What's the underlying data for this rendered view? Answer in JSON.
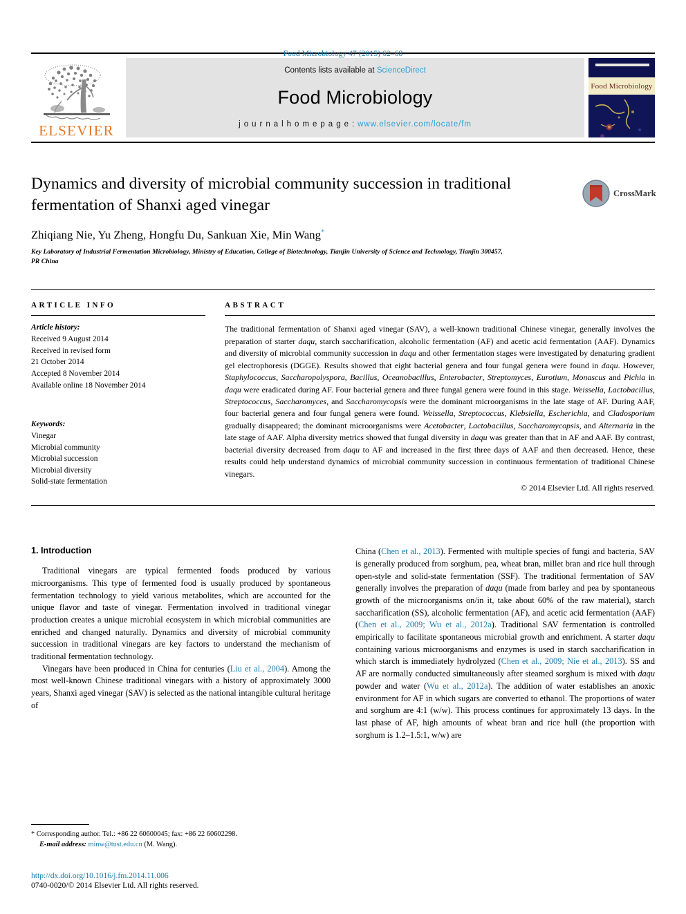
{
  "running_head": "Food Microbiology 47 (2015) 62–68",
  "masthead": {
    "publisher": "ELSEVIER",
    "contents_prefix": "Contents lists available at ",
    "contents_link": "ScienceDirect",
    "journal_name": "Food Microbiology",
    "homepage_prefix": "j o u r n a l   h o m e p a g e :  ",
    "homepage_link": "www.elsevier.com/locate/fm",
    "cover_title": "Food Microbiology"
  },
  "article": {
    "title": "Dynamics and diversity of microbial community succession in traditional fermentation of Shanxi aged vinegar",
    "authors": "Zhiqiang Nie, Yu Zheng, Hongfu Du, Sankuan Xie, Min Wang",
    "corresponding_marker": "*",
    "affiliation": "Key Laboratory of Industrial Fermentation Microbiology, Ministry of Education, College of Biotechnology, Tianjin University of Science and Technology, Tianjin 300457, PR China",
    "crossmark_label": "CrossMark"
  },
  "article_info": {
    "heading": "ARTICLE INFO",
    "history_label": "Article history:",
    "history": [
      "Received 9 August 2014",
      "Received in revised form",
      "21 October 2014",
      "Accepted 8 November 2014",
      "Available online 18 November 2014"
    ],
    "keywords_label": "Keywords:",
    "keywords": [
      "Vinegar",
      "Microbial community",
      "Microbial succession",
      "Microbial diversity",
      "Solid-state fermentation"
    ]
  },
  "abstract": {
    "heading": "ABSTRACT",
    "paragraph_html": "The traditional fermentation of Shanxi aged vinegar (SAV), a well-known traditional Chinese vinegar, generally involves the preparation of starter <i>daqu</i>, starch saccharification, alcoholic fermentation (AF) and acetic acid fermentation (AAF). Dynamics and diversity of microbial community succession in <i>daqu</i> and other fermentation stages were investigated by denaturing gradient gel electrophoresis (DGGE). Results showed that eight bacterial genera and four fungal genera were found in <i>daqu</i>. However, <i>Staphylococcus</i>, <i>Saccharopolyspora</i>, <i>Bacillus</i>, <i>Oceanobacillus</i>, <i>Enterobacter</i>, <i>Streptomyces</i>, <i>Eurotium</i>, <i>Monascus</i> and <i>Pichia</i> in <i>daqu</i> were eradicated during AF. Four bacterial genera and three fungal genera were found in this stage. <i>Weissella</i>, <i>Lactobacillus</i>, <i>Streptococcus</i>, <i>Saccharomyces</i>, and <i>Saccharomycopsis</i> were the dominant microorganisms in the late stage of AF. During AAF, four bacterial genera and four fungal genera were found. <i>Weissella</i>, <i>Streptococcus</i>, <i>Klebsiella</i>, <i>Escherichia</i>, and <i>Cladosporium</i> gradually disappeared; the dominant microorganisms were <i>Acetobacter</i>, <i>Lactobacillus</i>, <i>Saccharomycopsis</i>, and <i>Alternaria</i> in the late stage of AAF. Alpha diversity metrics showed that fungal diversity in <i>daqu</i> was greater than that in AF and AAF. By contrast, bacterial diversity decreased from <i>daqu</i> to AF and increased in the first three days of AAF and then decreased. Hence, these results could help understand dynamics of microbial community succession in continuous fermentation of traditional Chinese vinegars.",
    "copyright": "© 2014 Elsevier Ltd. All rights reserved."
  },
  "body": {
    "section_heading": "1. Introduction",
    "left_paragraphs_html": [
      "Traditional vinegars are typical fermented foods produced by various microorganisms. This type of fermented food is usually produced by spontaneous fermentation technology to yield various metabolites, which are accounted for the unique flavor and taste of vinegar. Fermentation involved in traditional vinegar production creates a unique microbial ecosystem in which microbial communities are enriched and changed naturally. Dynamics and diversity of microbial community succession in traditional vinegars are key factors to understand the mechanism of traditional fermentation technology.",
      "Vinegars have been produced in China for centuries (<a class=\"cite\" href=\"#\">Liu et al., 2004</a>). Among the most well-known Chinese traditional vinegars with a history of approximately 3000 years, Shanxi aged vinegar (SAV) is selected as the national intangible cultural heritage of"
    ],
    "right_paragraphs_html": [
      "China (<a class=\"cite\" href=\"#\">Chen et al., 2013</a>). Fermented with multiple species of fungi and bacteria, SAV is generally produced from sorghum, pea, wheat bran, millet bran and rice hull through open-style and solid-state fermentation (SSF). The traditional fermentation of SAV generally involves the preparation of <i>daqu</i> (made from barley and pea by spontaneous growth of the microorganisms on/in it, take about 60% of the raw material), starch saccharification (SS), alcoholic fermentation (AF), and acetic acid fermentation (AAF) (<a class=\"cite\" href=\"#\">Chen et al., 2009; Wu et al., 2012a</a>). Traditional SAV fermentation is controlled empirically to facilitate spontaneous microbial growth and enrichment. A starter <i>daqu</i> containing various microorganisms and enzymes is used in starch saccharification in which starch is immediately hydrolyzed (<a class=\"cite\" href=\"#\">Chen et al., 2009; Nie et al., 2013</a>). SS and AF are normally conducted simultaneously after steamed sorghum is mixed with <i>daqu</i> powder and water (<a class=\"cite\" href=\"#\">Wu et al., 2012a</a>). The addition of water establishes an anoxic environment for AF in which sugars are converted to ethanol. The proportions of water and sorghum are 4:1 (w/w). This process continues for approximately 13 days. In the last phase of AF, high amounts of wheat bran and rice hull (the proportion with sorghum is 1.2–1.5:1, w/w) are"
    ]
  },
  "footnote": {
    "line1": "* Corresponding author. Tel.: +86 22 60600045; fax: +86 22 60602298.",
    "email_label": "E-mail address:",
    "email": "minw@tust.edu.cn",
    "email_suffix": " (M. Wang)."
  },
  "footer": {
    "doi": "http://dx.doi.org/10.1016/j.fm.2014.11.006",
    "issn_line": "0740-0020/© 2014 Elsevier Ltd. All rights reserved."
  },
  "colors": {
    "link": "#1a7aa8",
    "science_direct": "#2a9fd6",
    "elsevier_orange": "#E87722",
    "cover_blue": "#0d1150"
  }
}
